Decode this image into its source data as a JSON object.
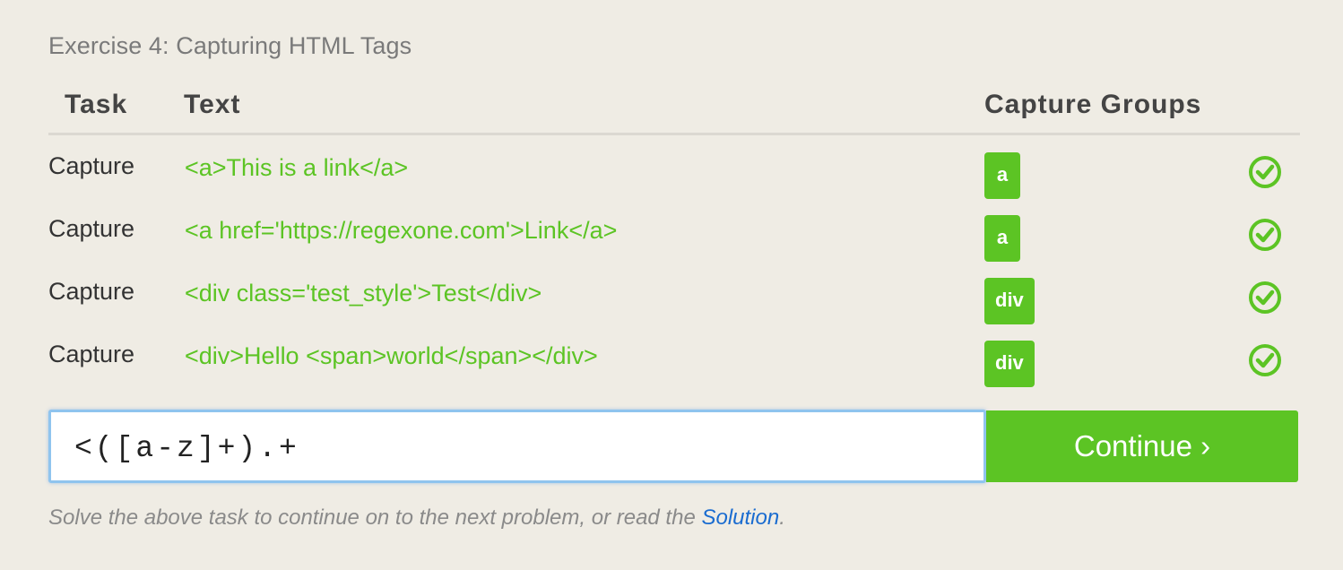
{
  "exercise": {
    "title": "Exercise 4: Capturing HTML Tags"
  },
  "table": {
    "headers": {
      "task": "Task",
      "text": "Text",
      "groups": "Capture Groups"
    },
    "rows": [
      {
        "task": "Capture",
        "text": "<a>This is a link</a>",
        "group": "a",
        "status": "check-circle-icon"
      },
      {
        "task": "Capture",
        "text": "<a href='https://regexone.com'>Link</a>",
        "group": "a",
        "status": "check-circle-icon"
      },
      {
        "task": "Capture",
        "text": "<div class='test_style'>Test</div>",
        "group": "div",
        "status": "check-circle-icon"
      },
      {
        "task": "Capture",
        "text": "<div>Hello <span>world</span></div>",
        "group": "div",
        "status": "check-circle-icon"
      }
    ]
  },
  "input": {
    "value": "<([a-z]+).+",
    "placeholder": ""
  },
  "continue_button": {
    "label": "Continue ›"
  },
  "footer": {
    "note_before": "Solve the above task to continue on to the next problem, or read the ",
    "link_label": "Solution",
    "note_after": "."
  },
  "colors": {
    "accent_green": "#5cc424",
    "link_blue": "#1a6cd0",
    "background": "#efece4"
  }
}
